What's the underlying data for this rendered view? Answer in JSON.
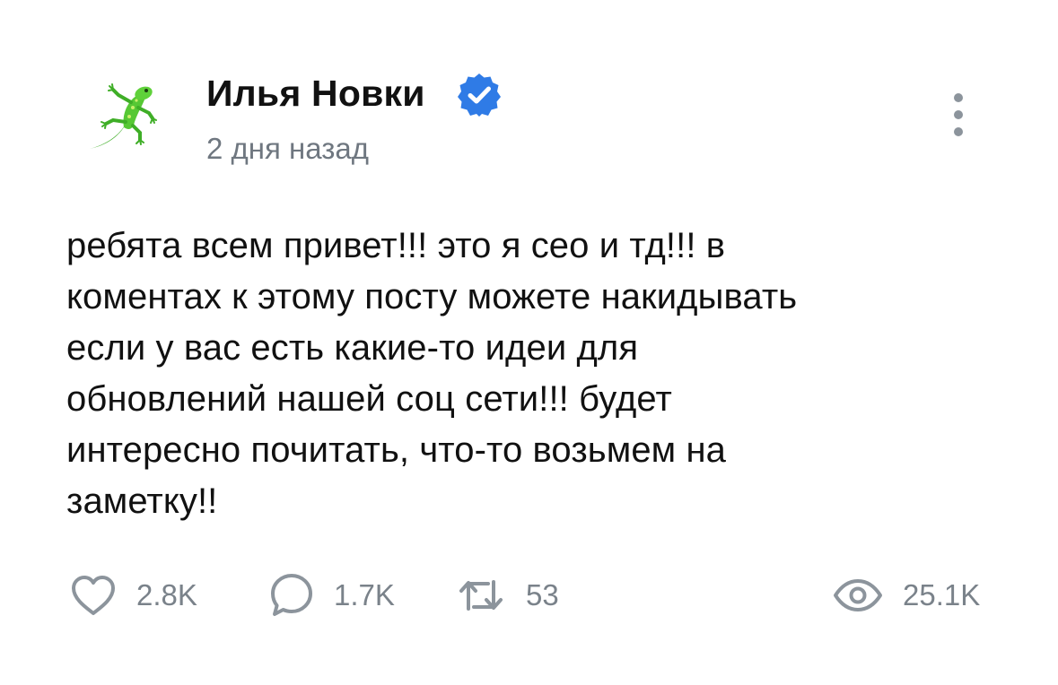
{
  "post": {
    "author_name": "Илья Новки",
    "timestamp": "2 дня назад",
    "text": "ребята всем привет!!! это я сео и тд!!! в\nкоментах к этому посту можете накидывать\nесли у вас есть какие-то идеи для\nобновлений нашей соц сети!!! будет\nинтересно почитать, что-то возьмем на\nзаметку!!",
    "avatar_icon": "lizard-icon",
    "verified_icon": "verified-badge-icon"
  },
  "actions": {
    "likes": "2.8K",
    "comments": "1.7K",
    "reposts": "53",
    "views": "25.1K"
  },
  "colors": {
    "verified_blue": "#2f7be6",
    "secondary_text": "#6f7780",
    "icon_gray": "#8c949c",
    "lizard_green": "#4fc22f"
  }
}
